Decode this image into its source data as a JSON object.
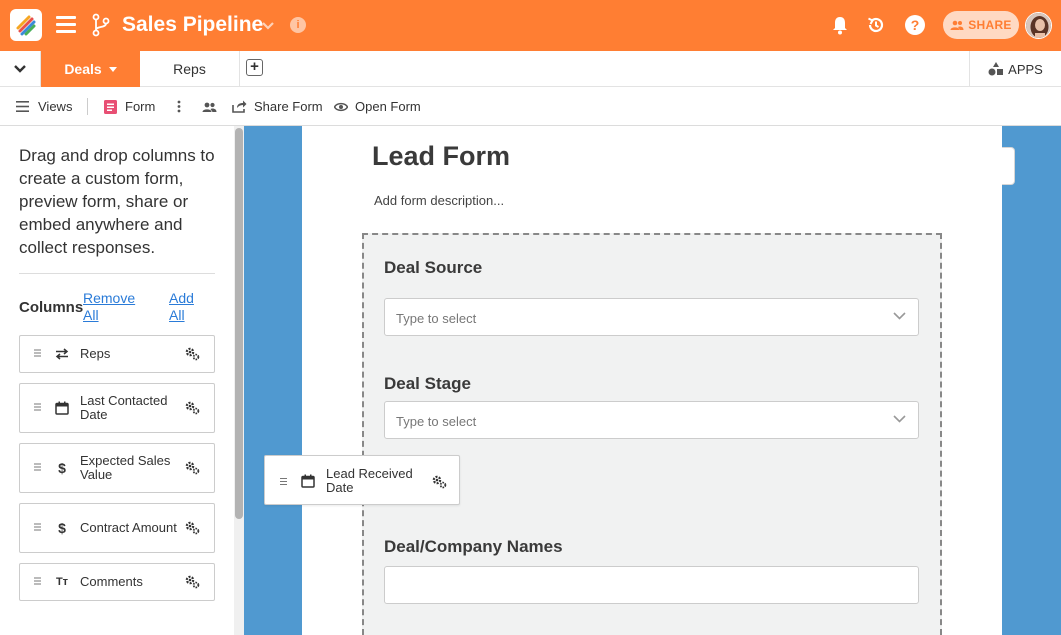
{
  "header": {
    "app_title": "Sales Pipeline",
    "share_label": "SHARE",
    "brand_color": "#ff7e33"
  },
  "tabs": {
    "items": [
      {
        "label": "Deals",
        "active": true
      },
      {
        "label": "Reps",
        "active": false
      }
    ],
    "apps_label": "APPS"
  },
  "toolbar": {
    "views_label": "Views",
    "form_label": "Form",
    "share_form_label": "Share Form",
    "open_form_label": "Open Form"
  },
  "left_panel": {
    "intro_text": "Drag and drop columns to create a custom form, preview form, share or embed anywhere and collect responses.",
    "columns_label": "Columns",
    "remove_all_label": "Remove All",
    "add_all_label": "Add All",
    "columns": [
      {
        "label": "Reps",
        "icon": "link-arrows-icon"
      },
      {
        "label": "Last Contacted Date",
        "icon": "calendar-icon"
      },
      {
        "label": "Expected Sales Value",
        "icon": "dollar-icon"
      },
      {
        "label": "Contract Amount",
        "icon": "dollar-icon"
      },
      {
        "label": "Comments",
        "icon": "text-type-icon"
      }
    ]
  },
  "form": {
    "title": "Lead Form",
    "description_placeholder": "Add form description...",
    "fields": [
      {
        "label": "Deal Source",
        "placeholder": "Type to select"
      },
      {
        "label": "Deal Stage",
        "placeholder": "Type to select"
      },
      {
        "label": "Deal/Company Names",
        "placeholder": ""
      }
    ]
  },
  "dragging_item": {
    "label": "Lead Received Date",
    "icon": "calendar-icon"
  }
}
